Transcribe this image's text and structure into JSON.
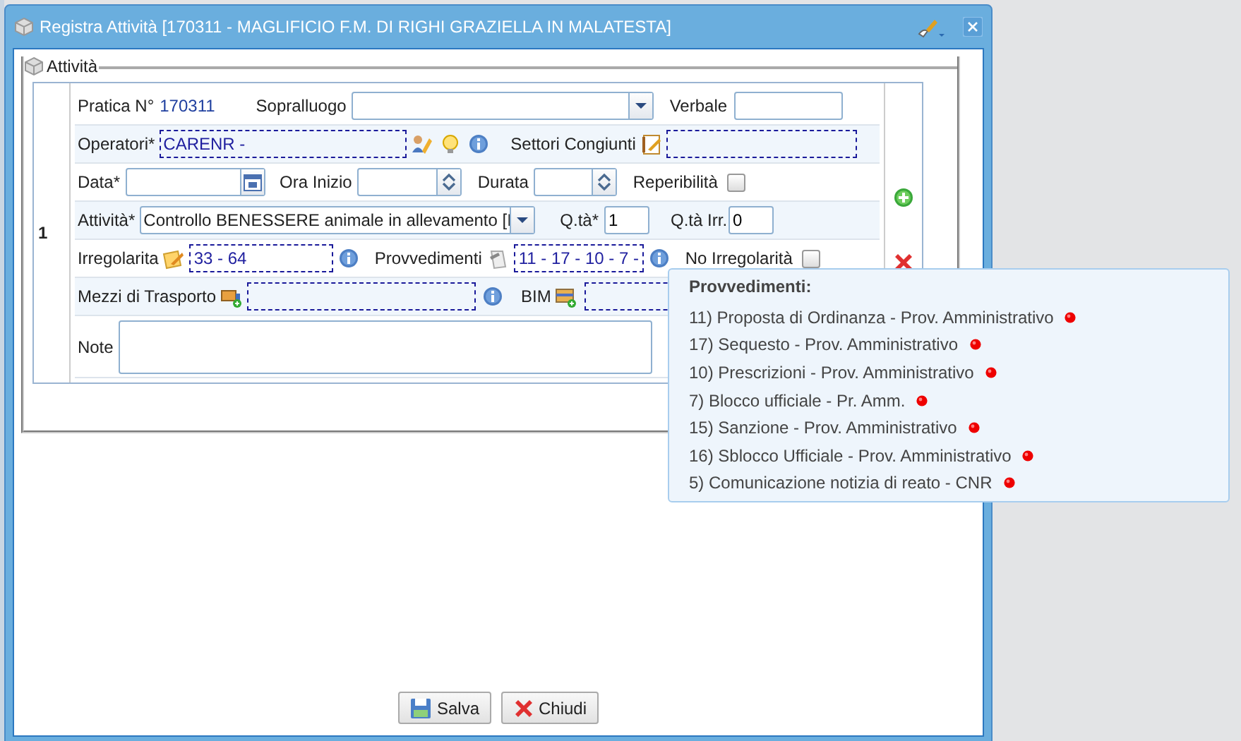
{
  "window": {
    "title": "Registra Attività [170311 - MAGLIFICIO F.M. DI RIGHI GRAZIELLA IN MALATESTA]"
  },
  "fieldset": {
    "legend": "Attività"
  },
  "record": {
    "number": "1",
    "pratica": {
      "label": "Pratica N°",
      "value": "170311"
    },
    "sopralluogo": {
      "label": "Sopralluogo"
    },
    "verbale": {
      "label": "Verbale"
    },
    "operatori": {
      "label": "Operatori*",
      "value": "CARENR -"
    },
    "settori": {
      "label": "Settori Congiunti"
    },
    "data": {
      "label": "Data*"
    },
    "ora_inizio": {
      "label": "Ora Inizio"
    },
    "durata": {
      "label": "Durata"
    },
    "reperibilita": {
      "label": "Reperibilità",
      "checked": false
    },
    "attivita": {
      "label": "Attività*",
      "value": "Controllo BENESSERE animale in allevamento [I"
    },
    "qta": {
      "label": "Q.tà*",
      "value": "1"
    },
    "qta_irr": {
      "label": "Q.tà Irr.",
      "value": "0"
    },
    "irregolarita": {
      "label": "Irregolarita",
      "value": "33 - 64"
    },
    "provvedimenti": {
      "label": "Provvedimenti",
      "value": "11 - 17 - 10 - 7 -"
    },
    "no_irregolarita": {
      "label": "No Irregolarità",
      "checked": false
    },
    "mezzi": {
      "label": "Mezzi di Trasporto"
    },
    "bim": {
      "label": "BIM"
    },
    "note": {
      "label": "Note"
    }
  },
  "tooltip": {
    "title": "Provvedimenti:",
    "items": [
      {
        "text": "11) Proposta di Ordinanza - Prov. Amministrativo"
      },
      {
        "text": "17) Sequesto - Prov. Amministrativo"
      },
      {
        "text": "10) Prescrizioni - Prov. Amministrativo"
      },
      {
        "text": "7) Blocco ufficiale - Pr. Amm."
      },
      {
        "text": "15) Sanzione - Prov. Amministrativo"
      },
      {
        "text": "16) Sblocco Ufficiale - Prov. Amministrativo"
      },
      {
        "text": "5) Comunicazione notizia di reato - CNR"
      }
    ]
  },
  "buttons": [
    {
      "label": "Salva",
      "kind": "save"
    },
    {
      "label": "Chiudi",
      "kind": "close"
    }
  ]
}
